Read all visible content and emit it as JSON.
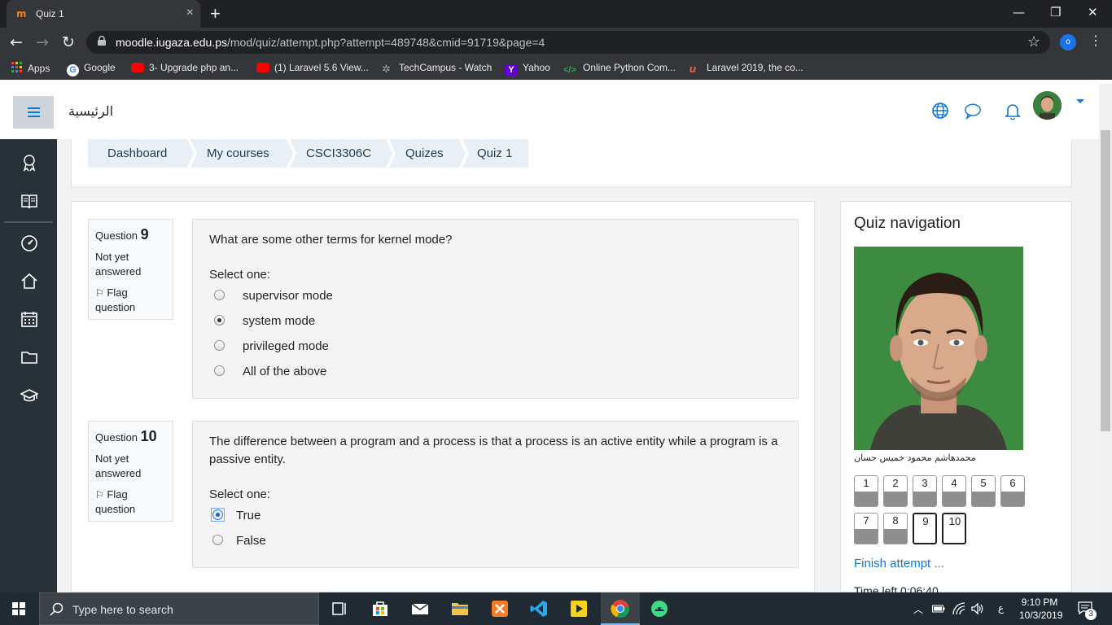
{
  "browser": {
    "tab_title": "Quiz 1",
    "url_host": "moodle.iugaza.edu.ps",
    "url_path": "/mod/quiz/attempt.php?attempt=489748&cmid=91719&page=4",
    "profile_initial": "o"
  },
  "bookmarks": [
    {
      "label": "Apps",
      "color": "#e8453c"
    },
    {
      "label": "Google",
      "color": "#4285f4"
    },
    {
      "label": "3- Upgrade php an...",
      "color": "#ff0000"
    },
    {
      "label": "(1) Laravel 5.6 View...",
      "color": "#ff0000"
    },
    {
      "label": "TechCampus - Watch",
      "color": "#9aa0a6"
    },
    {
      "label": "Yahoo",
      "color": "#6001d2"
    },
    {
      "label": "Online Python Com...",
      "color": "#2e7d32"
    },
    {
      "label": "Laravel 2019, the co...",
      "color": "#f4645f"
    }
  ],
  "header": {
    "site_name": "الرئيسية",
    "accent": "#1177d1"
  },
  "breadcrumb": [
    "Dashboard",
    "My courses",
    "CSCI3306C",
    "Quizes",
    "Quiz 1"
  ],
  "questions": [
    {
      "label": "Question",
      "number": "9",
      "status": "Not yet answered",
      "flag": "Flag question",
      "text": "What are some other terms for kernel mode?",
      "select_one": "Select one:",
      "options": [
        "supervisor mode",
        "system mode",
        "privileged mode",
        "All of the above"
      ],
      "selected_index": 1
    },
    {
      "label": "Question",
      "number": "10",
      "status": "Not yet answered",
      "flag": "Flag question",
      "text": "The difference between a program and a process is that a process is an active entity while a program is a passive entity.",
      "select_one": "Select one:",
      "options": [
        "True",
        "False"
      ],
      "selected_index": 0
    }
  ],
  "quiz_nav": {
    "title": "Quiz navigation",
    "student_name": "محمدهاشم محمود خميس حسان",
    "buttons": [
      {
        "label": "1",
        "answered": true,
        "current": false
      },
      {
        "label": "2",
        "answered": true,
        "current": false
      },
      {
        "label": "3",
        "answered": true,
        "current": false
      },
      {
        "label": "4",
        "answered": true,
        "current": false
      },
      {
        "label": "5",
        "answered": true,
        "current": false
      },
      {
        "label": "6",
        "answered": true,
        "current": false
      },
      {
        "label": "7",
        "answered": true,
        "current": false
      },
      {
        "label": "8",
        "answered": true,
        "current": false
      },
      {
        "label": "9",
        "answered": false,
        "current": true
      },
      {
        "label": "10",
        "answered": false,
        "current": true
      }
    ],
    "finish": "Finish attempt ...",
    "time_left": "Time left 0:06:40"
  },
  "taskbar": {
    "search_placeholder": "Type here to search",
    "time": "9:10 PM",
    "date": "10/3/2019",
    "lang": "ع",
    "notifications": "3"
  }
}
